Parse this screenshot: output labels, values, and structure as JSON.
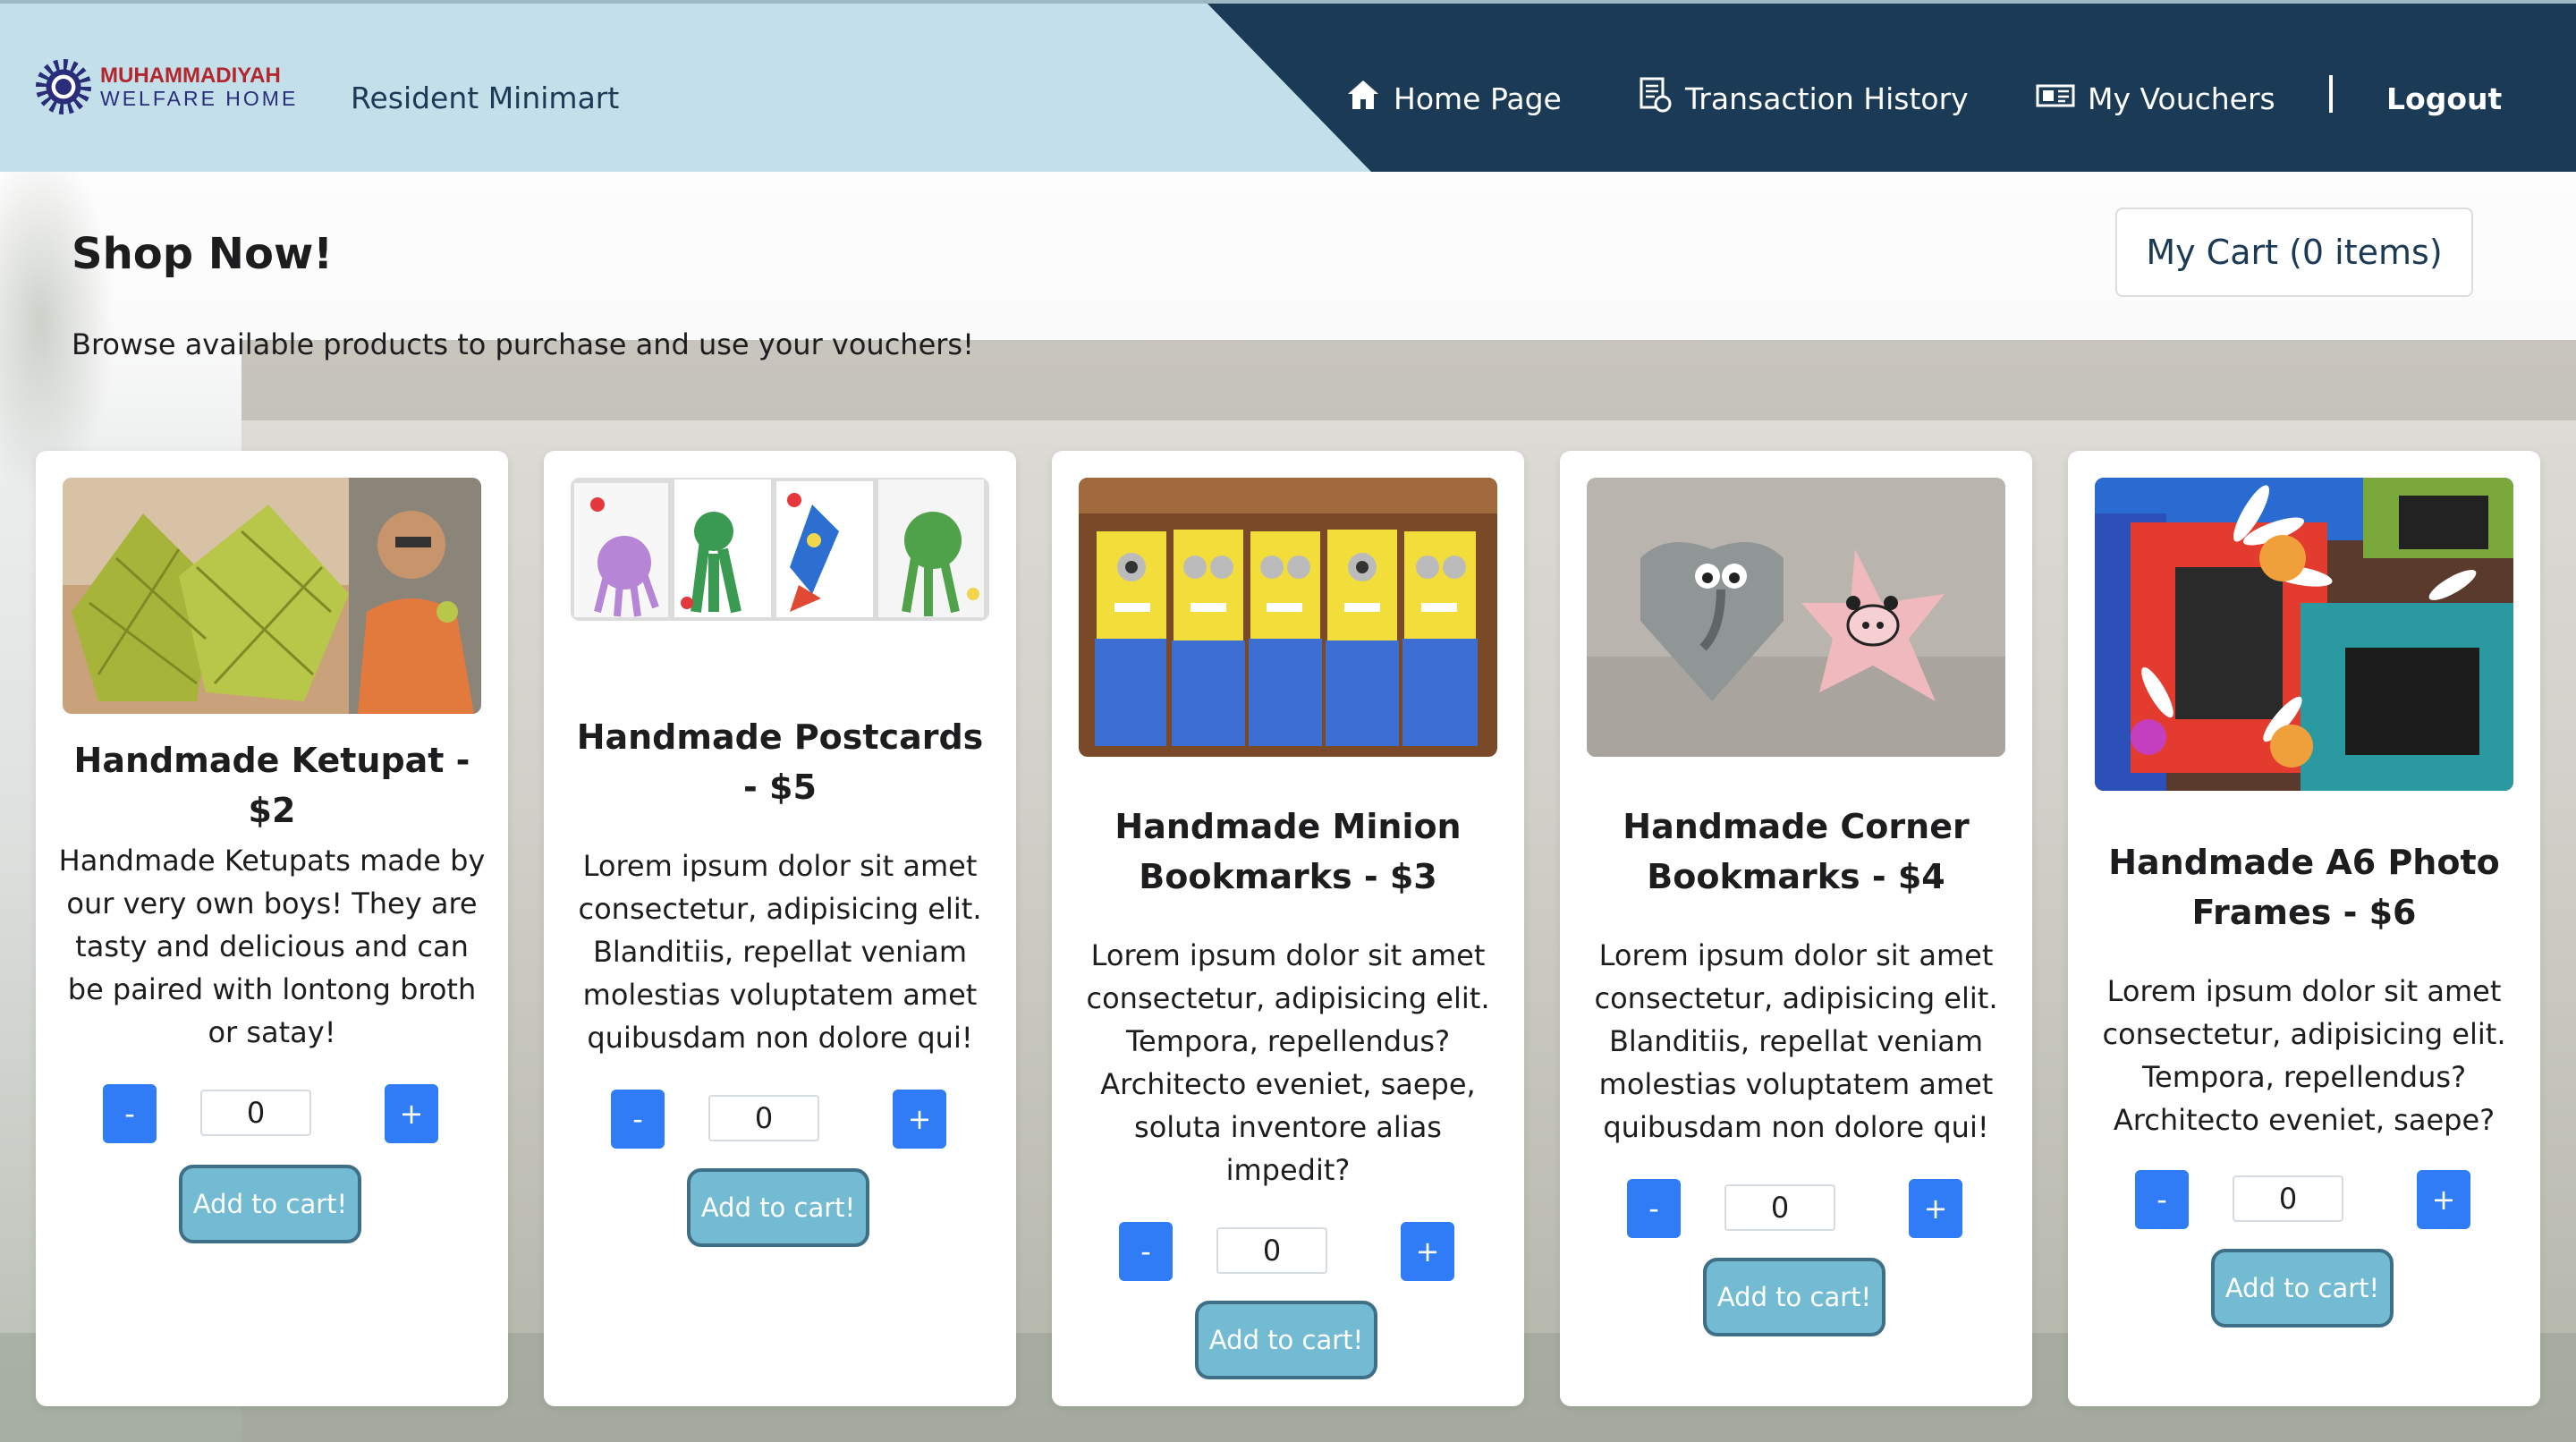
{
  "header": {
    "logo_line1": "MUHAMMADIYAH",
    "logo_line2": "WELFARE HOME",
    "app_title": "Resident Minimart",
    "nav": {
      "home": "Home Page",
      "transactions": "Transaction History",
      "vouchers": "My Vouchers",
      "logout": "Logout"
    }
  },
  "page": {
    "title": "Shop Now!",
    "subtitle": "Browse available products to purchase and use your vouchers!",
    "cart_label": "My Cart (0 items)"
  },
  "products": [
    {
      "name": "Handmade Ketupat - $2",
      "description": "Handmade Ketupats made by our very own boys! They are tasty and delicious and can be paired with lontong broth or satay!",
      "quantity": "0",
      "minus": "-",
      "plus": "+",
      "add_label": "Add to cart!"
    },
    {
      "name": "Handmade Postcards - $5",
      "description": "Lorem ipsum dolor sit amet consectetur, adipisicing elit. Blanditiis, repellat veniam molestias voluptatem amet quibusdam non dolore qui!",
      "quantity": "0",
      "minus": "-",
      "plus": "+",
      "add_label": "Add to cart!"
    },
    {
      "name": "Handmade Minion Bookmarks - $3",
      "description": "Lorem ipsum dolor sit amet consectetur, adipisicing elit. Tempora, repellendus? Architecto eveniet, saepe, soluta inventore alias impedit?",
      "quantity": "0",
      "minus": "-",
      "plus": "+",
      "add_label": "Add to cart!"
    },
    {
      "name": "Handmade Corner Bookmarks - $4",
      "description": "Lorem ipsum dolor sit amet consectetur, adipisicing elit. Blanditiis, repellat veniam molestias voluptatem amet quibusdam non dolore qui!",
      "quantity": "0",
      "minus": "-",
      "plus": "+",
      "add_label": "Add to cart!"
    },
    {
      "name": "Handmade A6 Photo Frames - $6",
      "description": "Lorem ipsum dolor sit amet consectetur, adipisicing elit. Tempora, repellendus? Architecto eveniet, saepe?",
      "quantity": "0",
      "minus": "-",
      "plus": "+",
      "add_label": "Add to cart!"
    }
  ],
  "colors": {
    "header_light": "#c3dfea",
    "header_dark": "#1b3a55",
    "qty_button": "#2f7cf6",
    "add_button": "#73bbd2"
  },
  "icons": {
    "home": "home-icon",
    "transactions": "receipt-icon",
    "vouchers": "voucher-icon",
    "logo": "logo-emblem-icon"
  }
}
